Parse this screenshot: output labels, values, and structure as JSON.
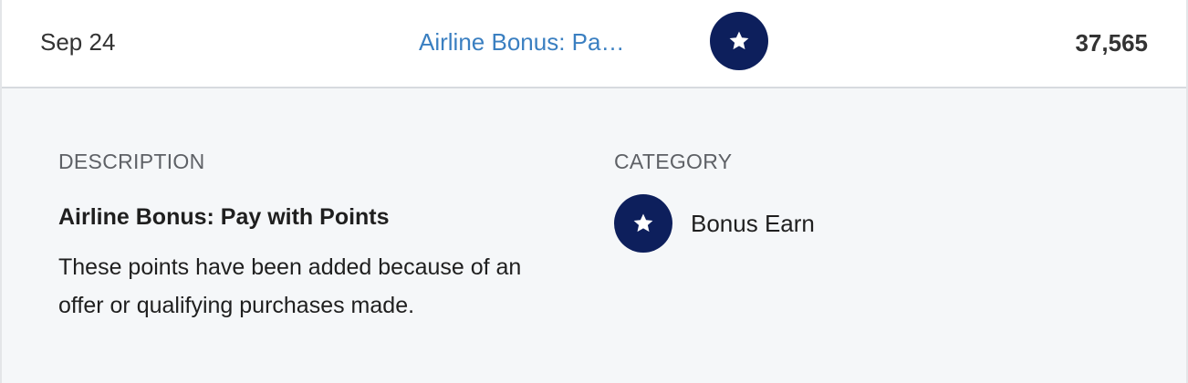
{
  "transaction": {
    "date": "Sep 24",
    "description_short": "Airline Bonus: Pa…",
    "category_icon": "star-icon",
    "points": "37,565"
  },
  "details": {
    "description_label": "DESCRIPTION",
    "description_title": "Airline Bonus: Pay with Points",
    "description_body": "These points have been added because of an offer or qualifying purchases made.",
    "category_label": "CATEGORY",
    "category_icon": "star-icon",
    "category_name": "Bonus Earn"
  },
  "colors": {
    "icon_circle": "#0d1f5c",
    "icon_glyph": "#ffffff",
    "link": "#3a7fc1",
    "row_background": "#ffffff",
    "detail_background": "#f5f7f9"
  }
}
